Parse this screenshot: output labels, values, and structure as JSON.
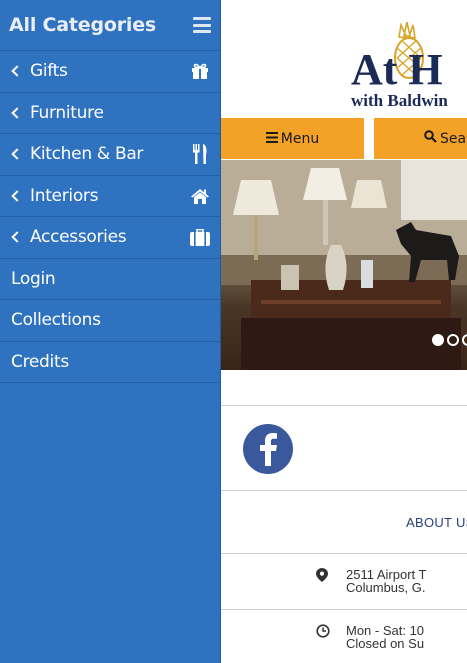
{
  "drawer": {
    "title": "All Categories",
    "items": [
      {
        "label": "Gifts",
        "icon": "gift-icon",
        "has_arrow": true
      },
      {
        "label": "Furniture",
        "icon": "",
        "has_arrow": true
      },
      {
        "label": "Kitchen & Bar",
        "icon": "utensils-icon",
        "has_arrow": true
      },
      {
        "label": "Interiors",
        "icon": "home-icon",
        "has_arrow": true
      },
      {
        "label": "Accessories",
        "icon": "briefcase-icon",
        "has_arrow": true
      },
      {
        "label": "Login",
        "icon": "",
        "has_arrow": false
      },
      {
        "label": "Collections",
        "icon": "",
        "has_arrow": false
      },
      {
        "label": "Credits",
        "icon": "",
        "has_arrow": false
      }
    ]
  },
  "logo": {
    "text_main": "At H",
    "text_sub": "with Baldwin"
  },
  "nav": {
    "menu_label": "Menu",
    "search_label": "Sear"
  },
  "social": {
    "icon": "facebook-icon"
  },
  "about_label": "ABOUT US",
  "address": {
    "line1": "2511 Airport T",
    "line2": "Columbus, G."
  },
  "hours": {
    "line1": "Mon - Sat: 10",
    "line2": "Closed on Su"
  },
  "colors": {
    "drawer_bg": "#2f72c0",
    "nav_btn": "#f3a227",
    "facebook": "#3a589c",
    "logo_gold": "#d9a528",
    "logo_navy": "#1b2a56"
  }
}
